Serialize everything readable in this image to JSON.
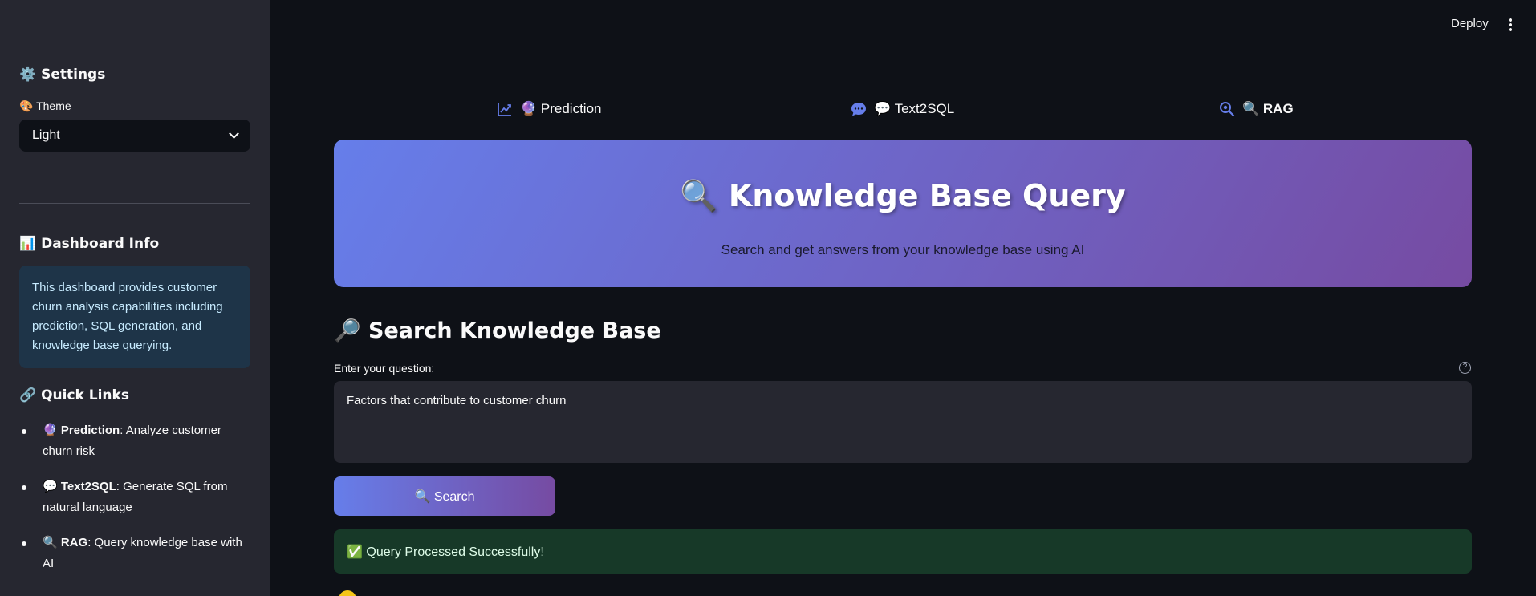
{
  "header": {
    "deploy_label": "Deploy",
    "menu_icon": "kebab-menu-icon"
  },
  "sidebar": {
    "settings_title": "⚙️ Settings",
    "theme_label": "🎨 Theme",
    "theme_value": "Light",
    "dashboard_title": "📊 Dashboard Info",
    "dashboard_text": "This dashboard provides customer churn analysis capabilities including prediction, SQL generation, and knowledge base querying.",
    "quick_links_title": "🔗 Quick Links",
    "links": [
      {
        "name": "🔮 Prediction",
        "desc": ": Analyze customer churn risk"
      },
      {
        "name": "💬 Text2SQL",
        "desc": ": Generate SQL from natural language"
      },
      {
        "name": "🔍 RAG",
        "desc": ": Query knowledge base with AI"
      }
    ]
  },
  "nav": {
    "tabs": [
      {
        "label": "🔮 Prediction",
        "icon": "chart-line-icon"
      },
      {
        "label": "💬 Text2SQL",
        "icon": "chat-bubble-icon"
      },
      {
        "label": "🔍 RAG",
        "icon": "search-icon",
        "active": true
      }
    ]
  },
  "hero": {
    "title": "🔍 Knowledge Base Query",
    "subtitle": "Search and get answers from your knowledge base using AI"
  },
  "main": {
    "section_title": "🔎 Search Knowledge Base",
    "question_label": "Enter your question:",
    "help_icon": "?",
    "question_value": "Factors that contribute to customer churn",
    "search_button": "🔍 Search",
    "success_message": "✅ Query Processed Successfully!"
  },
  "colors": {
    "accent_start": "#667eea",
    "accent_end": "#764ba2",
    "active_icon": "#667eea"
  }
}
